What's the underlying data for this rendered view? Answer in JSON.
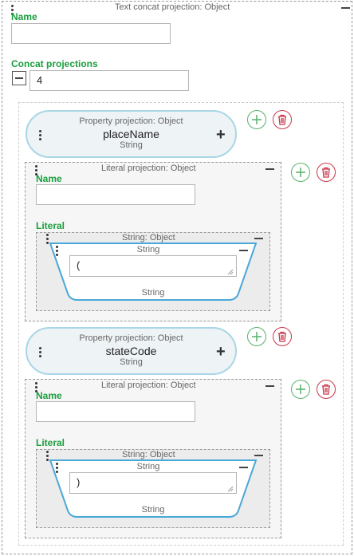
{
  "root": {
    "caption": "Text concat projection: Object",
    "name_label": "Name",
    "name_value": "",
    "concat_label": "Concat projections",
    "concat_count": "4"
  },
  "items": [
    {
      "kind": "property",
      "caption": "Property projection: Object",
      "name": "placeName",
      "type": "String"
    },
    {
      "kind": "literal",
      "caption": "Literal projection: Object",
      "name_label": "Name",
      "name_value": "",
      "literal_label": "Literal",
      "string_caption": "String: Object",
      "string_header": "String",
      "value": "(",
      "string_footer": "String"
    },
    {
      "kind": "property",
      "caption": "Property projection: Object",
      "name": "stateCode",
      "type": "String"
    },
    {
      "kind": "literal",
      "caption": "Literal projection: Object",
      "name_label": "Name",
      "name_value": "",
      "literal_label": "Literal",
      "string_caption": "String: Object",
      "string_header": "String",
      "value": ")",
      "string_footer": "String"
    }
  ],
  "colors": {
    "label_green": "#1b9e3e",
    "add_green": "#56b06a",
    "delete_red": "#c8374a",
    "pill_border": "#a9d6e6",
    "string_border": "#4aa8d8"
  },
  "icons": {
    "drag": "drag-handle-icon",
    "collapse": "minus-icon",
    "expand": "plus-icon",
    "add": "add-circle-icon",
    "delete": "trash-icon"
  }
}
